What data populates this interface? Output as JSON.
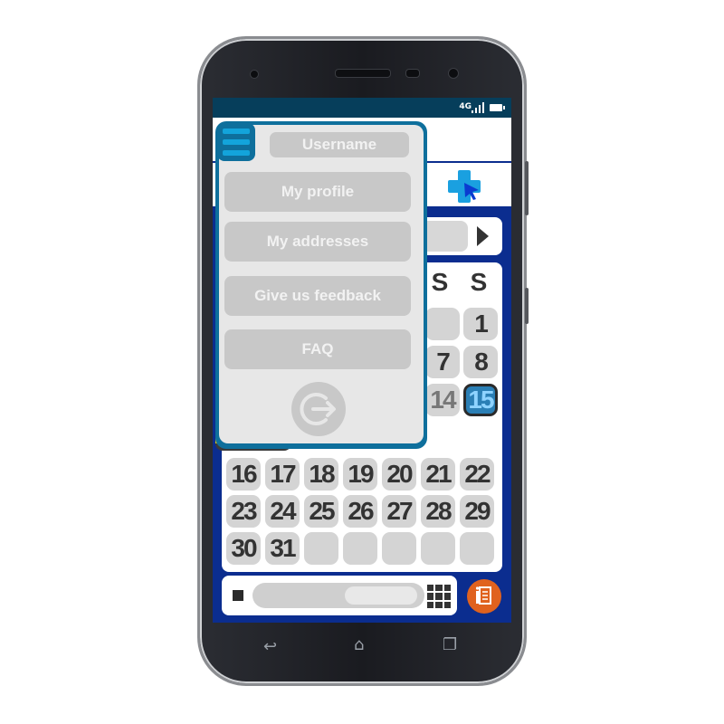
{
  "status_bar": {
    "network": "4G"
  },
  "calendar": {
    "weekday_headers": [
      "S",
      "S"
    ],
    "rows": [
      [
        "",
        "1"
      ],
      [
        "7",
        "8"
      ],
      [
        "14",
        "15"
      ],
      [
        "16",
        "17",
        "18",
        "19",
        "20",
        "21",
        "22"
      ],
      [
        "23",
        "24",
        "25",
        "26",
        "27",
        "28",
        "29"
      ],
      [
        "30",
        "31",
        "",
        "",
        "",
        "",
        ""
      ]
    ],
    "today": "15"
  },
  "drawer": {
    "username": "Username",
    "items": [
      "My profile",
      "My addresses",
      "Give us feedback",
      "FAQ"
    ]
  },
  "colors": {
    "screen_bg": "#0b2d8f",
    "drawer_frame": "#0e6f9c",
    "accent_blue": "#13a4db",
    "fab_orange": "#e0621e"
  }
}
